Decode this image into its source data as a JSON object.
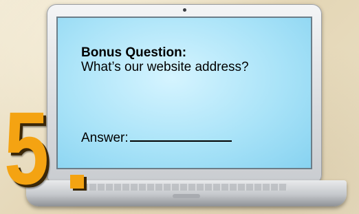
{
  "question": {
    "heading": "Bonus Question:",
    "body": "What’s our website address?",
    "answer_label": "Answer:"
  },
  "badge": {
    "number": "5"
  },
  "colors": {
    "screen": "#a9e3f8",
    "number": "#f4a312",
    "background": "#eadfc4"
  }
}
